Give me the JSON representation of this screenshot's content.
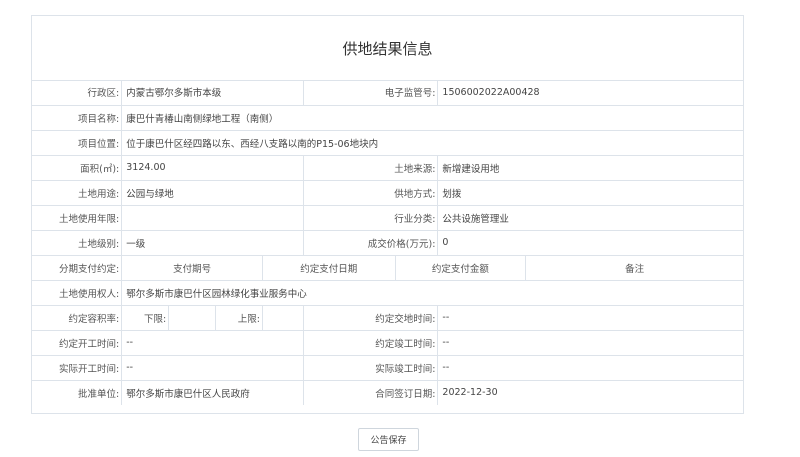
{
  "title": "供地结果信息",
  "rows": {
    "admin_region": {
      "label": "行政区:",
      "value": "内蒙古鄂尔多斯市本级"
    },
    "supervision_no": {
      "label": "电子监管号:",
      "value": "1506002022A00428"
    },
    "project_name": {
      "label": "项目名称:",
      "value": "康巴什青椿山南侧绿地工程（南侧）"
    },
    "project_location": {
      "label": "项目位置:",
      "value": "位于康巴什区经四路以东、西经八支路以南的P15-06地块内"
    },
    "area": {
      "label": "面积(㎡):",
      "value": "3124.00"
    },
    "land_source": {
      "label": "土地来源:",
      "value": "新增建设用地"
    },
    "land_use": {
      "label": "土地用途:",
      "value": "公园与绿地"
    },
    "supply_method": {
      "label": "供地方式:",
      "value": "划拨"
    },
    "use_years": {
      "label": "土地使用年限:",
      "value": ""
    },
    "industry": {
      "label": "行业分类:",
      "value": "公共设施管理业"
    },
    "land_grade": {
      "label": "土地级别:",
      "value": "一级"
    },
    "deal_price": {
      "label": "成交价格(万元):",
      "value": "0"
    },
    "installment": {
      "label": "分期支付约定:",
      "cols": [
        "支付期号",
        "约定支付日期",
        "约定支付金额",
        "备注"
      ]
    },
    "land_user": {
      "label": "土地使用权人:",
      "value": "鄂尔多斯市康巴什区园林绿化事业服务中心"
    },
    "plot_ratio": {
      "label": "约定容积率:",
      "lower_label": "下限:",
      "lower_value": "",
      "upper_label": "上限:",
      "upper_value": ""
    },
    "handover_time": {
      "label": "约定交地时间:",
      "value": "--"
    },
    "start_time": {
      "label": "约定开工时间:",
      "value": "--"
    },
    "finish_time": {
      "label": "约定竣工时间:",
      "value": "--"
    },
    "actual_start": {
      "label": "实际开工时间:",
      "value": "--"
    },
    "actual_finish": {
      "label": "实际竣工时间:",
      "value": "--"
    },
    "approval_unit": {
      "label": "批准单位:",
      "value": "鄂尔多斯市康巴什区人民政府"
    },
    "contract_date": {
      "label": "合同签订日期:",
      "value": "2022-12-30"
    }
  },
  "save_button": "公告保存"
}
